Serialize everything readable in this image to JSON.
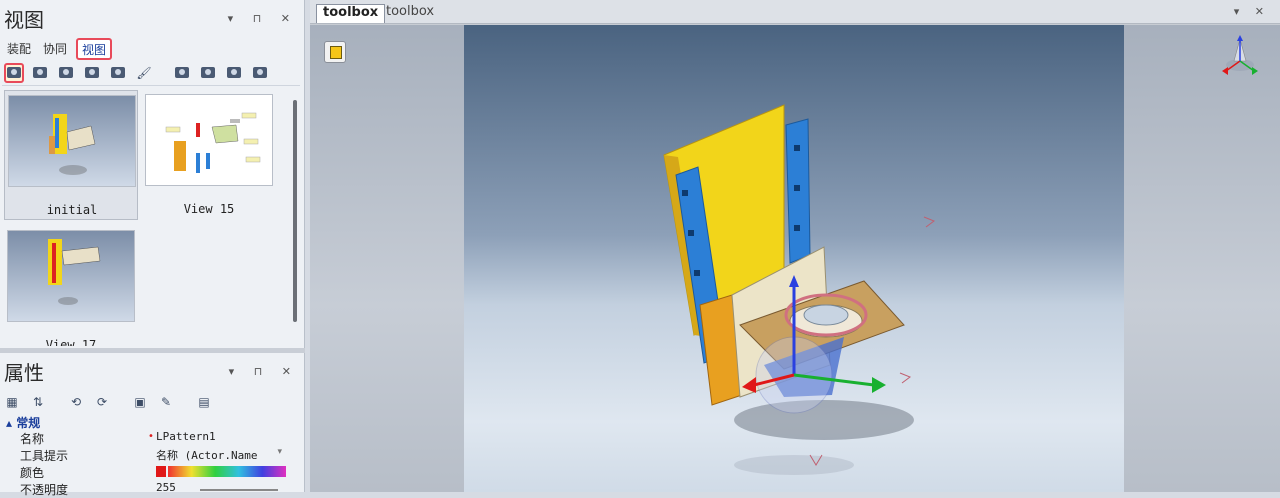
{
  "left_panel": {
    "title": "视图",
    "controls": "▾ ⊓ ✕",
    "tabs": [
      "装配",
      "协同",
      "视图"
    ],
    "active_tab": "视图",
    "thumbnails": [
      {
        "caption": "initial",
        "selected": true
      },
      {
        "caption": "View 15",
        "selected": false
      },
      {
        "caption": "View 17",
        "selected": false
      }
    ]
  },
  "props_panel": {
    "title": "属性",
    "controls": "▾ ⊓ ✕",
    "category": "常规",
    "rows": [
      {
        "key": "名称",
        "value": "LPattern1"
      },
      {
        "key": "工具提示",
        "value": "名称 (Actor.Name"
      },
      {
        "key": "颜色",
        "value": ""
      },
      {
        "key": "不透明度",
        "value": "255"
      }
    ]
  },
  "document": {
    "tabs": [
      "toolbox",
      "toolbox"
    ],
    "active_tab": "toolbox",
    "controls": "▾ ✕"
  },
  "colors": {
    "accent_red": "#e84a5a",
    "part_yellow": "#f2d51a",
    "part_blue": "#2c7fd6"
  }
}
